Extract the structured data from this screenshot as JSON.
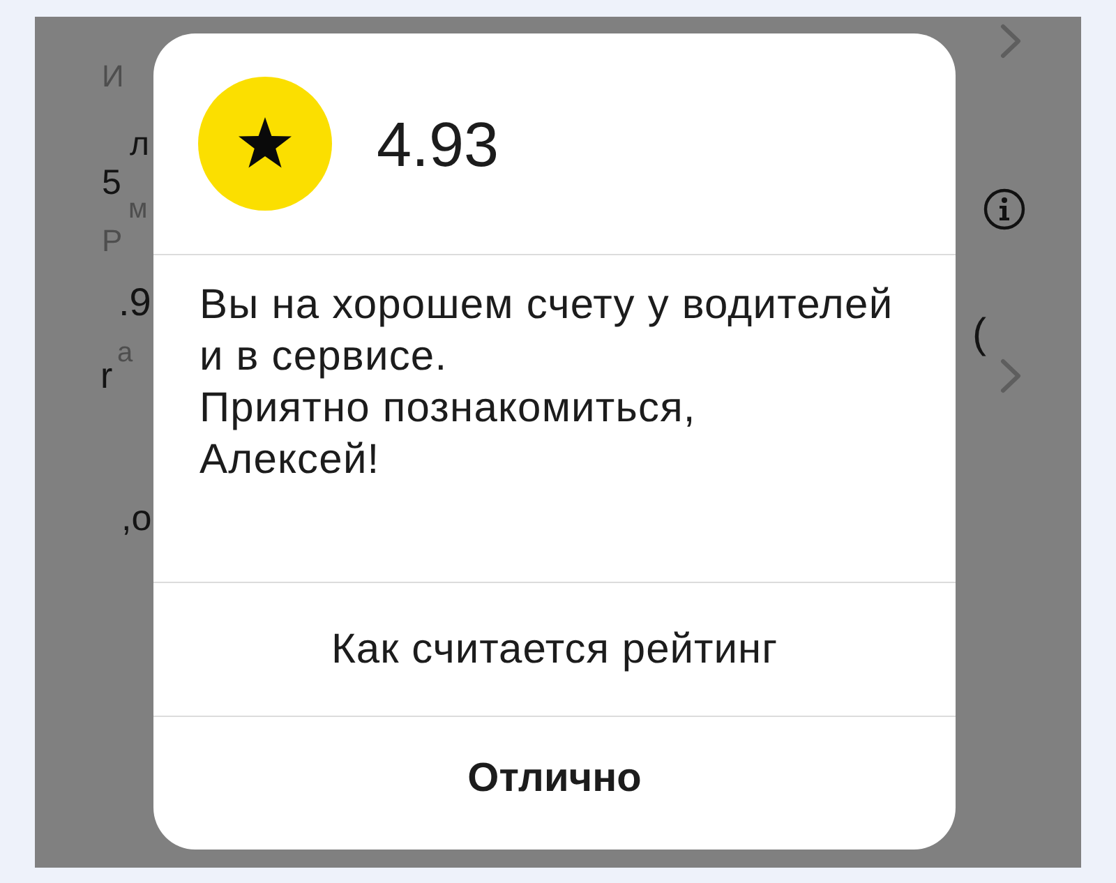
{
  "background": {
    "left_fragments": [
      {
        "text": "И",
        "kind": "secondary"
      },
      {
        "text": "л",
        "kind": "primary"
      },
      {
        "text": "5",
        "kind": "primary"
      },
      {
        "text": "м",
        "kind": "secondary"
      },
      {
        "text": "Р",
        "kind": "secondary"
      },
      {
        "text": ".9",
        "kind": "primary"
      },
      {
        "text": "а",
        "kind": "secondary"
      },
      {
        "text": "r",
        "kind": "primary"
      },
      {
        "text": ",о",
        "kind": "primary"
      }
    ],
    "right_items": [
      {
        "kind": "chevron"
      },
      {
        "kind": "info"
      },
      {
        "kind": "text",
        "text": "("
      },
      {
        "kind": "chevron"
      }
    ]
  },
  "dialog": {
    "rating": "4.93",
    "message": "Вы на хорошем счету у водителей\nи в сервисе.\nПриятно познакомиться,\nАлексей!",
    "actions": [
      {
        "label": "Как считается рейтинг",
        "kind": "link"
      },
      {
        "label": "Отлично",
        "kind": "primary"
      }
    ]
  }
}
